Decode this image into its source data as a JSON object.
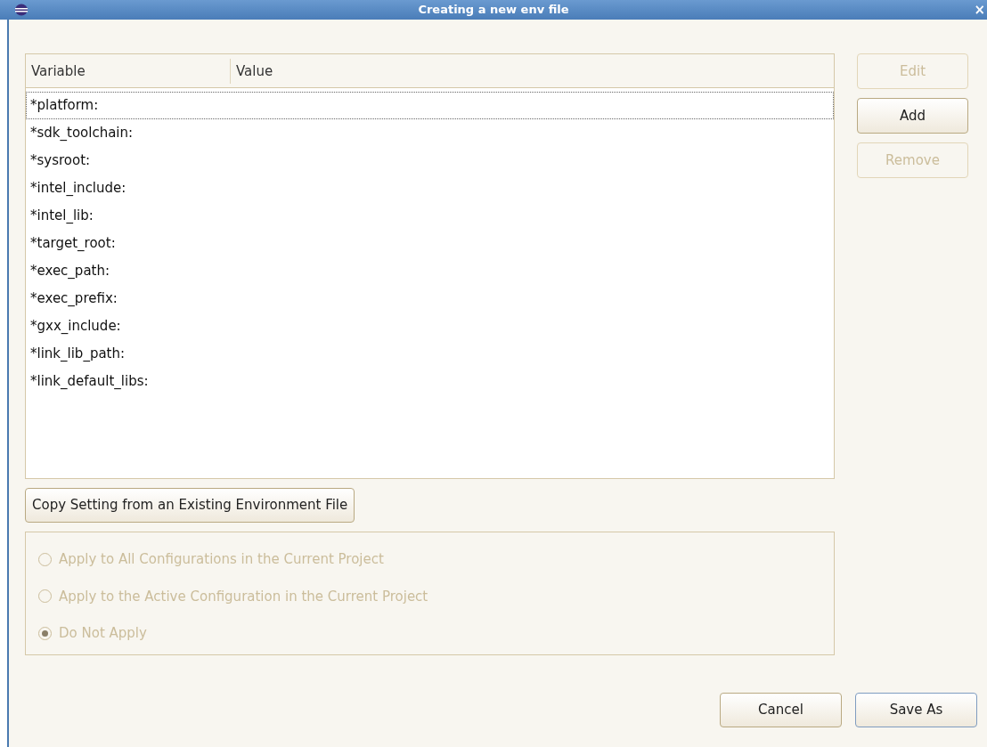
{
  "window": {
    "title": "Creating a new env file",
    "close": "×"
  },
  "table": {
    "columns": [
      "Variable",
      "Value"
    ],
    "rows": [
      {
        "variable": "*platform:",
        "selected": true
      },
      {
        "variable": "*sdk_toolchain:",
        "selected": false
      },
      {
        "variable": "*sysroot:",
        "selected": false
      },
      {
        "variable": "*intel_include:",
        "selected": false
      },
      {
        "variable": "*intel_lib:",
        "selected": false
      },
      {
        "variable": "*target_root:",
        "selected": false
      },
      {
        "variable": "*exec_path:",
        "selected": false
      },
      {
        "variable": "*exec_prefix:",
        "selected": false
      },
      {
        "variable": "*gxx_include:",
        "selected": false
      },
      {
        "variable": "*link_lib_path:",
        "selected": false
      },
      {
        "variable": "*link_default_libs:",
        "selected": false
      }
    ]
  },
  "side_buttons": [
    {
      "label": "Edit",
      "disabled": true
    },
    {
      "label": "Add",
      "disabled": false
    },
    {
      "label": "Remove",
      "disabled": true
    }
  ],
  "copy_button": {
    "label": "Copy Setting from an Existing Environment File"
  },
  "apply_options": {
    "disabled": true,
    "options": [
      {
        "label": "Apply to All Configurations in the Current Project",
        "selected": false
      },
      {
        "label": "Apply to the Active Configuration in the Current Project",
        "selected": false
      },
      {
        "label": "Do Not Apply",
        "selected": true
      }
    ]
  },
  "footer_buttons": [
    {
      "label": "Cancel",
      "default": false
    },
    {
      "label": "Save As",
      "default": true
    }
  ]
}
